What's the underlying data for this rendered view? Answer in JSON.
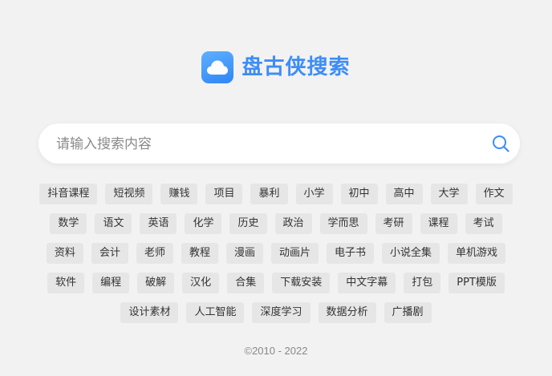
{
  "brand": {
    "name": "盘古侠搜索",
    "color": "#3d8df6"
  },
  "search": {
    "placeholder": "请输入搜索内容",
    "value": ""
  },
  "tag_rows": [
    [
      "抖音课程",
      "短视频",
      "赚钱",
      "项目",
      "暴利",
      "小学",
      "初中",
      "高中",
      "大学",
      "作文"
    ],
    [
      "数学",
      "语文",
      "英语",
      "化学",
      "历史",
      "政治",
      "学而思",
      "考研",
      "课程",
      "考试"
    ],
    [
      "资料",
      "会计",
      "老师",
      "教程",
      "漫画",
      "动画片",
      "电子书",
      "小说全集",
      "单机游戏"
    ],
    [
      "软件",
      "编程",
      "破解",
      "汉化",
      "合集",
      "下载安装",
      "中文字幕",
      "打包",
      "PPT模版"
    ],
    [
      "设计素材",
      "人工智能",
      "深度学习",
      "数据分析",
      "广播剧"
    ]
  ],
  "footer": {
    "copyright": "©2010 - 2022"
  }
}
